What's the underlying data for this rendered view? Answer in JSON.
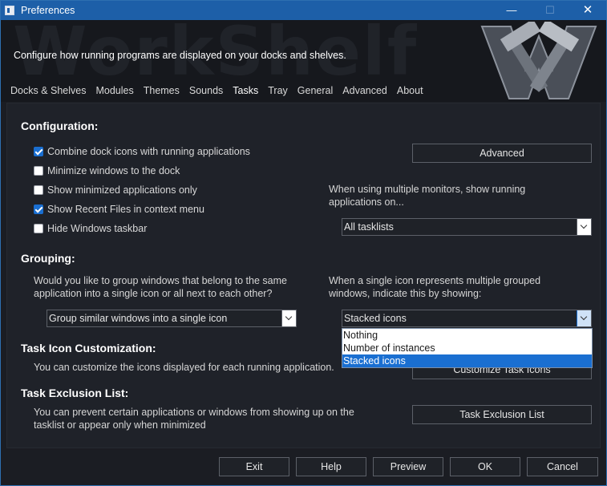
{
  "window": {
    "title": "Preferences",
    "controls": {
      "minimize": "—",
      "maximize": "☐",
      "close": "✕"
    }
  },
  "header": {
    "description": "Configure how running programs are displayed on your docks and shelves.",
    "watermark": "WorkShelf",
    "tabs": [
      {
        "label": "Docks & Shelves",
        "active": false
      },
      {
        "label": "Modules",
        "active": false
      },
      {
        "label": "Themes",
        "active": false
      },
      {
        "label": "Sounds",
        "active": false
      },
      {
        "label": "Tasks",
        "active": true
      },
      {
        "label": "Tray",
        "active": false
      },
      {
        "label": "General",
        "active": false
      },
      {
        "label": "Advanced",
        "active": false
      },
      {
        "label": "About",
        "active": false
      }
    ]
  },
  "configuration": {
    "title": "Configuration:",
    "checkboxes": [
      {
        "label": "Combine dock icons with running applications",
        "checked": true
      },
      {
        "label": "Minimize windows to the dock",
        "checked": false
      },
      {
        "label": "Show minimized applications only",
        "checked": false
      },
      {
        "label": "Show Recent Files in context menu",
        "checked": true
      },
      {
        "label": "Hide Windows taskbar",
        "checked": false
      }
    ],
    "advanced_button": "Advanced",
    "monitors_text": "When using multiple monitors, show running applications on...",
    "monitors_select": "All tasklists"
  },
  "grouping": {
    "title": "Grouping:",
    "question": "Would you like to group windows that belong to the same application into a single icon or all next to each other?",
    "group_select": "Group similar windows into a single icon",
    "indicate_text": "When a single icon represents multiple grouped windows, indicate this by showing:",
    "indicate_select": "Stacked icons",
    "indicate_options": [
      "Nothing",
      "Number of instances",
      "Stacked icons"
    ]
  },
  "customization": {
    "title": "Task Icon Customization:",
    "text": "You can customize the icons displayed for each running application.",
    "button": "Customize Task Icons"
  },
  "exclusion": {
    "title": "Task Exclusion List:",
    "text": "You can prevent certain applications or windows from showing up on the tasklist or appear only when minimized",
    "button": "Task Exclusion List"
  },
  "footer": {
    "exit": "Exit",
    "help": "Help",
    "preview": "Preview",
    "ok": "OK",
    "cancel": "Cancel"
  }
}
